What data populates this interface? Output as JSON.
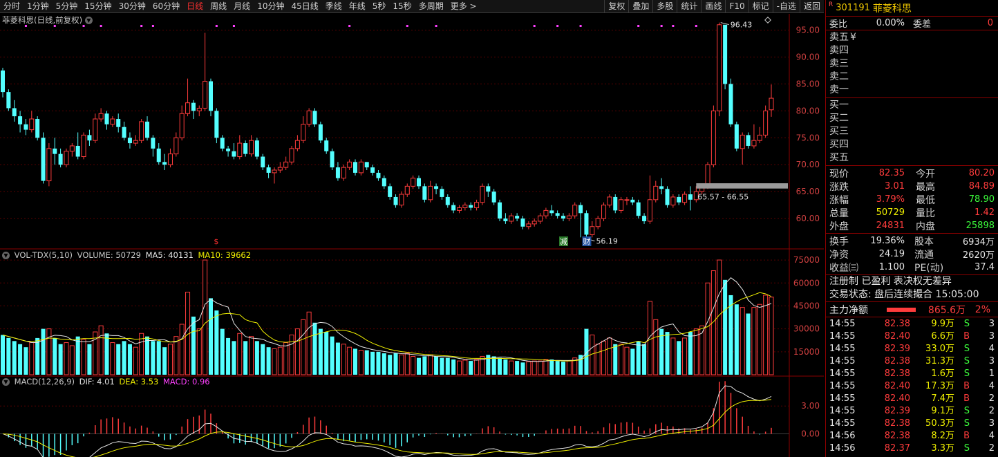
{
  "toolbar": {
    "periods": [
      "分时",
      "1分钟",
      "5分钟",
      "15分钟",
      "30分钟",
      "60分钟",
      "日线",
      "周线",
      "月线",
      "10分钟",
      "45日线",
      "季线",
      "年线",
      "5秒",
      "15秒",
      "多周期",
      "更多 >"
    ],
    "active_period": "日线",
    "right_buttons": [
      "复权",
      "叠加",
      "多股",
      "统计",
      "画线",
      "F10",
      "标记",
      "-自选",
      "返回"
    ]
  },
  "main_chart": {
    "title": "菲菱科思(日线,前复权)",
    "y_ticks": [
      "95.00",
      "90.00",
      "85.00",
      "80.00",
      "75.00",
      "70.00",
      "65.00",
      "60.00"
    ],
    "high_label": "96.43",
    "low_label": "56.19",
    "range_label": "65.57 - 66.55",
    "markers": {
      "dollar": "$",
      "cai": "财",
      "jian": "减"
    }
  },
  "volume_panel": {
    "name": "VOL-TDX(5,10)",
    "volume": "VOLUME: 50729",
    "ma5": "MA5: 40131",
    "ma10": "MA10: 39662",
    "y_ticks": [
      "75000",
      "60000",
      "45000",
      "30000",
      "15000"
    ]
  },
  "macd_panel": {
    "name": "MACD(12,26,9)",
    "dif": "DIF: 4.01",
    "dea": "DEA: 3.53",
    "macd": "MACD: 0.96",
    "y_ticks": [
      "3.00",
      "0.00"
    ]
  },
  "quote": {
    "code": "301191",
    "name": "菲菱科思",
    "r_mark": "R",
    "weibi_label": "委比",
    "weibi": "0.00%",
    "weicha_label": "委差",
    "weicha": "0",
    "sell": [
      "卖五",
      "卖四",
      "卖三",
      "卖二",
      "卖一"
    ],
    "sell_currency": "¥",
    "buy": [
      "买一",
      "买二",
      "买三",
      "买四",
      "买五"
    ],
    "stats": [
      {
        "l1": "现价",
        "v1": "82.35",
        "c1": "red",
        "l2": "今开",
        "v2": "80.20",
        "c2": "red"
      },
      {
        "l1": "涨跌",
        "v1": "3.01",
        "c1": "red",
        "l2": "最高",
        "v2": "84.89",
        "c2": "red"
      },
      {
        "l1": "涨幅",
        "v1": "3.79%",
        "c1": "red",
        "l2": "最低",
        "v2": "78.90",
        "c2": "green"
      },
      {
        "l1": "总量",
        "v1": "50729",
        "c1": "yellow",
        "l2": "量比",
        "v2": "1.42",
        "c2": "red"
      },
      {
        "l1": "外盘",
        "v1": "24831",
        "c1": "red",
        "l2": "内盘",
        "v2": "25898",
        "c2": "green"
      }
    ],
    "fund": [
      {
        "l1": "换手",
        "v1": "19.36%",
        "l2": "股本",
        "v2": "6934万"
      },
      {
        "l1": "净资",
        "v1": "24.19",
        "l2": "流通",
        "v2": "2620万"
      },
      {
        "l1": "收益㈢",
        "v1": "1.100",
        "l2": "PE(动)",
        "v2": "37.4"
      }
    ],
    "note1": "注册制 已盈利 表决权无差异",
    "note2": "交易状态: 盘后连续撮合 15:05:00",
    "mainflow_label": "主力净额",
    "mainflow_value": "865.6万",
    "mainflow_pct": "2%",
    "trades": [
      {
        "t": "14:55",
        "p": "82.38",
        "v": "9.9万",
        "d": "S",
        "n": "3"
      },
      {
        "t": "14:55",
        "p": "82.40",
        "v": "6.6万",
        "d": "B",
        "n": "3"
      },
      {
        "t": "14:55",
        "p": "82.39",
        "v": "33.0万",
        "d": "S",
        "n": "4"
      },
      {
        "t": "14:55",
        "p": "82.38",
        "v": "31.3万",
        "d": "S",
        "n": "3"
      },
      {
        "t": "14:55",
        "p": "82.38",
        "v": "1.6万",
        "d": "S",
        "n": "1"
      },
      {
        "t": "14:55",
        "p": "82.40",
        "v": "17.3万",
        "d": "B",
        "n": "4"
      },
      {
        "t": "14:55",
        "p": "82.40",
        "v": "7.4万",
        "d": "B",
        "n": "2"
      },
      {
        "t": "14:55",
        "p": "82.39",
        "v": "9.1万",
        "d": "S",
        "n": "2"
      },
      {
        "t": "14:55",
        "p": "82.38",
        "v": "50.3万",
        "d": "S",
        "n": "3"
      },
      {
        "t": "14:56",
        "p": "82.38",
        "v": "8.2万",
        "d": "B",
        "n": "4"
      },
      {
        "t": "14:56",
        "p": "82.37",
        "v": "3.3万",
        "d": "S",
        "n": "2"
      }
    ]
  },
  "chart_data": {
    "type": "candlestick",
    "price_range": [
      55,
      97
    ],
    "volume_range": [
      0,
      80000
    ],
    "macd_range": [
      -2.5,
      6
    ],
    "candles": [
      [
        87.5,
        83.5,
        88.0,
        82.5,
        26000
      ],
      [
        83.5,
        80.5,
        84.0,
        80.0,
        24000
      ],
      [
        80.5,
        79.0,
        82.0,
        78.0,
        22000
      ],
      [
        79.0,
        77.5,
        80.0,
        76.0,
        20000
      ],
      [
        77.5,
        76.5,
        78.5,
        75.5,
        18000
      ],
      [
        76.5,
        78.5,
        80.0,
        76.0,
        21000
      ],
      [
        78.5,
        75.0,
        79.0,
        74.5,
        24000
      ],
      [
        75.0,
        67.0,
        76.0,
        66.5,
        30000
      ],
      [
        67.0,
        73.0,
        74.0,
        66.0,
        30000
      ],
      [
        73.0,
        72.0,
        75.0,
        70.0,
        24000
      ],
      [
        72.0,
        70.0,
        73.0,
        69.5,
        20000
      ],
      [
        70.0,
        72.5,
        73.0,
        69.5,
        21000
      ],
      [
        72.5,
        73.5,
        74.0,
        71.5,
        19000
      ],
      [
        73.5,
        71.5,
        76.0,
        71.0,
        25000
      ],
      [
        71.5,
        75.5,
        76.0,
        71.0,
        23000
      ],
      [
        75.5,
        74.5,
        76.5,
        73.5,
        20000
      ],
      [
        74.5,
        78.5,
        79.5,
        74.0,
        28000
      ],
      [
        78.5,
        79.5,
        80.5,
        78.0,
        32000
      ],
      [
        79.5,
        77.5,
        80.0,
        76.5,
        27000
      ],
      [
        77.5,
        78.5,
        79.0,
        77.0,
        21000
      ],
      [
        78.5,
        77.0,
        79.5,
        76.0,
        20000
      ],
      [
        77.0,
        75.0,
        78.0,
        74.5,
        22000
      ],
      [
        75.0,
        74.0,
        76.0,
        73.0,
        20000
      ],
      [
        74.0,
        74.5,
        75.5,
        73.5,
        18000
      ],
      [
        74.5,
        78.0,
        78.5,
        74.0,
        27000
      ],
      [
        78.0,
        75.0,
        79.0,
        74.5,
        25000
      ],
      [
        75.0,
        73.0,
        75.5,
        71.5,
        22000
      ],
      [
        73.0,
        70.5,
        74.0,
        70.0,
        22000
      ],
      [
        70.5,
        70.0,
        72.0,
        69.0,
        18000
      ],
      [
        70.0,
        72.0,
        73.0,
        69.5,
        20000
      ],
      [
        72.0,
        75.0,
        76.0,
        71.5,
        25000
      ],
      [
        75.0,
        79.5,
        81.0,
        74.5,
        33000
      ],
      [
        79.5,
        81.5,
        86.0,
        79.0,
        54000
      ],
      [
        81.5,
        80.0,
        82.0,
        78.5,
        38000
      ],
      [
        80.0,
        80.5,
        81.0,
        79.0,
        30000
      ],
      [
        80.5,
        85.5,
        94.5,
        80.0,
        75000
      ],
      [
        85.5,
        80.0,
        86.0,
        79.0,
        50000
      ],
      [
        80.0,
        75.0,
        80.5,
        74.0,
        42000
      ],
      [
        75.0,
        73.0,
        75.5,
        72.5,
        30000
      ],
      [
        73.0,
        72.5,
        73.5,
        71.5,
        24000
      ],
      [
        72.5,
        71.5,
        74.0,
        71.0,
        22000
      ],
      [
        71.5,
        74.0,
        75.5,
        71.0,
        27000
      ],
      [
        74.0,
        72.0,
        74.5,
        71.5,
        22000
      ],
      [
        72.0,
        74.5,
        75.5,
        71.5,
        25000
      ],
      [
        74.5,
        71.5,
        75.0,
        71.0,
        22000
      ],
      [
        71.5,
        69.5,
        72.0,
        69.0,
        20000
      ],
      [
        69.5,
        68.5,
        70.0,
        67.5,
        18000
      ],
      [
        68.5,
        69.0,
        69.5,
        66.5,
        17000
      ],
      [
        69.0,
        69.5,
        70.5,
        68.5,
        18000
      ],
      [
        69.5,
        70.5,
        71.5,
        69.0,
        21000
      ],
      [
        70.5,
        73.0,
        73.5,
        70.0,
        26000
      ],
      [
        73.0,
        74.5,
        75.5,
        72.5,
        30000
      ],
      [
        74.5,
        77.5,
        79.0,
        74.0,
        36000
      ],
      [
        77.5,
        80.0,
        80.5,
        77.0,
        41000
      ],
      [
        80.0,
        77.5,
        80.5,
        77.0,
        34000
      ],
      [
        77.5,
        74.5,
        78.0,
        74.0,
        30000
      ],
      [
        74.5,
        72.5,
        75.0,
        72.0,
        28000
      ],
      [
        72.5,
        69.5,
        73.0,
        69.0,
        25000
      ],
      [
        69.5,
        67.5,
        70.5,
        67.0,
        21000
      ],
      [
        67.5,
        69.5,
        70.0,
        67.0,
        20000
      ],
      [
        69.5,
        70.5,
        71.0,
        69.0,
        18000
      ],
      [
        70.5,
        68.5,
        71.0,
        68.0,
        17000
      ],
      [
        68.5,
        70.5,
        71.0,
        68.0,
        16000
      ],
      [
        70.5,
        69.5,
        70.5,
        69.0,
        16000
      ],
      [
        69.5,
        68.5,
        70.0,
        68.0,
        15000
      ],
      [
        68.5,
        67.5,
        69.0,
        67.0,
        15000
      ],
      [
        67.5,
        66.0,
        68.0,
        65.5,
        14000
      ],
      [
        66.0,
        64.0,
        66.5,
        63.5,
        13000
      ],
      [
        64.0,
        62.5,
        64.5,
        62.0,
        14000
      ],
      [
        62.5,
        64.5,
        65.0,
        62.0,
        13000
      ],
      [
        64.5,
        66.0,
        66.5,
        64.0,
        14000
      ],
      [
        66.0,
        67.5,
        68.0,
        65.5,
        12000
      ],
      [
        67.5,
        66.0,
        68.0,
        65.5,
        11000
      ],
      [
        66.0,
        63.5,
        66.5,
        63.0,
        12000
      ],
      [
        63.5,
        66.0,
        67.0,
        63.0,
        13000
      ],
      [
        66.0,
        65.5,
        66.5,
        64.5,
        12000
      ],
      [
        65.5,
        64.0,
        66.0,
        63.5,
        11000
      ],
      [
        64.0,
        62.5,
        64.5,
        62.0,
        11000
      ],
      [
        62.5,
        61.5,
        63.0,
        61.0,
        10000
      ],
      [
        61.5,
        62.0,
        62.5,
        61.0,
        9000
      ],
      [
        62.0,
        62.5,
        63.0,
        61.5,
        9500
      ],
      [
        62.5,
        62.0,
        63.0,
        61.5,
        9000
      ],
      [
        62.0,
        63.0,
        63.5,
        61.5,
        10000
      ],
      [
        63.0,
        66.0,
        66.5,
        62.5,
        12000
      ],
      [
        66.0,
        65.0,
        66.5,
        64.0,
        13000
      ],
      [
        65.0,
        63.0,
        65.5,
        62.5,
        12000
      ],
      [
        63.0,
        60.0,
        63.5,
        59.5,
        11000
      ],
      [
        60.0,
        59.5,
        61.0,
        59.0,
        10000
      ],
      [
        59.5,
        60.5,
        61.0,
        59.0,
        9000
      ],
      [
        60.5,
        60.0,
        61.0,
        59.5,
        9000
      ],
      [
        60.0,
        58.5,
        60.5,
        58.0,
        8000
      ],
      [
        58.5,
        59.0,
        59.5,
        58.0,
        8500
      ],
      [
        59.0,
        59.5,
        60.0,
        58.5,
        9000
      ],
      [
        59.5,
        60.5,
        61.0,
        59.0,
        9000
      ],
      [
        60.5,
        61.5,
        62.0,
        60.0,
        10000
      ],
      [
        61.5,
        61.0,
        62.5,
        60.5,
        10000
      ],
      [
        61.0,
        60.5,
        61.5,
        60.0,
        9000
      ],
      [
        60.5,
        60.0,
        61.0,
        59.5,
        8500
      ],
      [
        60.0,
        60.5,
        61.0,
        59.5,
        9000
      ],
      [
        60.5,
        62.5,
        63.0,
        60.0,
        11000
      ],
      [
        62.5,
        61.0,
        63.0,
        56.5,
        13000
      ],
      [
        61.0,
        57.0,
        61.5,
        56.2,
        30000
      ],
      [
        57.0,
        58.5,
        59.5,
        56.5,
        26000
      ],
      [
        58.5,
        60.0,
        60.5,
        58.0,
        20000
      ],
      [
        60.0,
        62.5,
        63.0,
        59.5,
        22000
      ],
      [
        62.5,
        64.0,
        64.5,
        62.0,
        24000
      ],
      [
        64.0,
        61.5,
        64.5,
        61.0,
        20000
      ],
      [
        61.5,
        63.5,
        64.0,
        61.0,
        20000
      ],
      [
        63.5,
        63.5,
        64.0,
        62.5,
        18000
      ],
      [
        63.5,
        63.0,
        64.0,
        62.5,
        17000
      ],
      [
        63.0,
        60.5,
        63.5,
        60.0,
        22000
      ],
      [
        60.5,
        59.5,
        61.0,
        59.0,
        20000
      ],
      [
        59.5,
        63.5,
        68.0,
        59.0,
        48000
      ],
      [
        63.5,
        66.0,
        67.0,
        63.0,
        36000
      ],
      [
        66.0,
        65.5,
        67.5,
        64.5,
        30000
      ],
      [
        65.5,
        62.5,
        66.0,
        62.0,
        28000
      ],
      [
        62.5,
        64.0,
        64.5,
        62.0,
        24000
      ],
      [
        64.0,
        63.0,
        64.5,
        62.5,
        22000
      ],
      [
        63.0,
        64.5,
        65.0,
        62.5,
        24000
      ],
      [
        64.5,
        63.5,
        66.0,
        61.5,
        28000
      ],
      [
        63.5,
        65.0,
        66.0,
        63.0,
        30000
      ],
      [
        65.0,
        66.0,
        66.5,
        64.5,
        32000
      ],
      [
        66.0,
        70.0,
        70.5,
        65.5,
        60000
      ],
      [
        70.0,
        80.0,
        81.0,
        69.5,
        68000
      ],
      [
        80.0,
        96.0,
        96.4,
        79.0,
        75000
      ],
      [
        96.0,
        85.0,
        92.0,
        84.0,
        62000
      ],
      [
        85.0,
        77.5,
        86.0,
        77.0,
        52000
      ],
      [
        77.5,
        73.0,
        78.0,
        72.5,
        46000
      ],
      [
        73.0,
        75.5,
        76.0,
        70.0,
        44000
      ],
      [
        75.5,
        73.5,
        76.0,
        73.0,
        40000
      ],
      [
        73.5,
        74.5,
        77.5,
        73.0,
        44000
      ],
      [
        74.5,
        75.5,
        77.0,
        74.0,
        46000
      ],
      [
        75.5,
        80.0,
        81.0,
        75.0,
        52000
      ],
      [
        80.2,
        82.35,
        84.89,
        78.9,
        50729
      ]
    ]
  }
}
